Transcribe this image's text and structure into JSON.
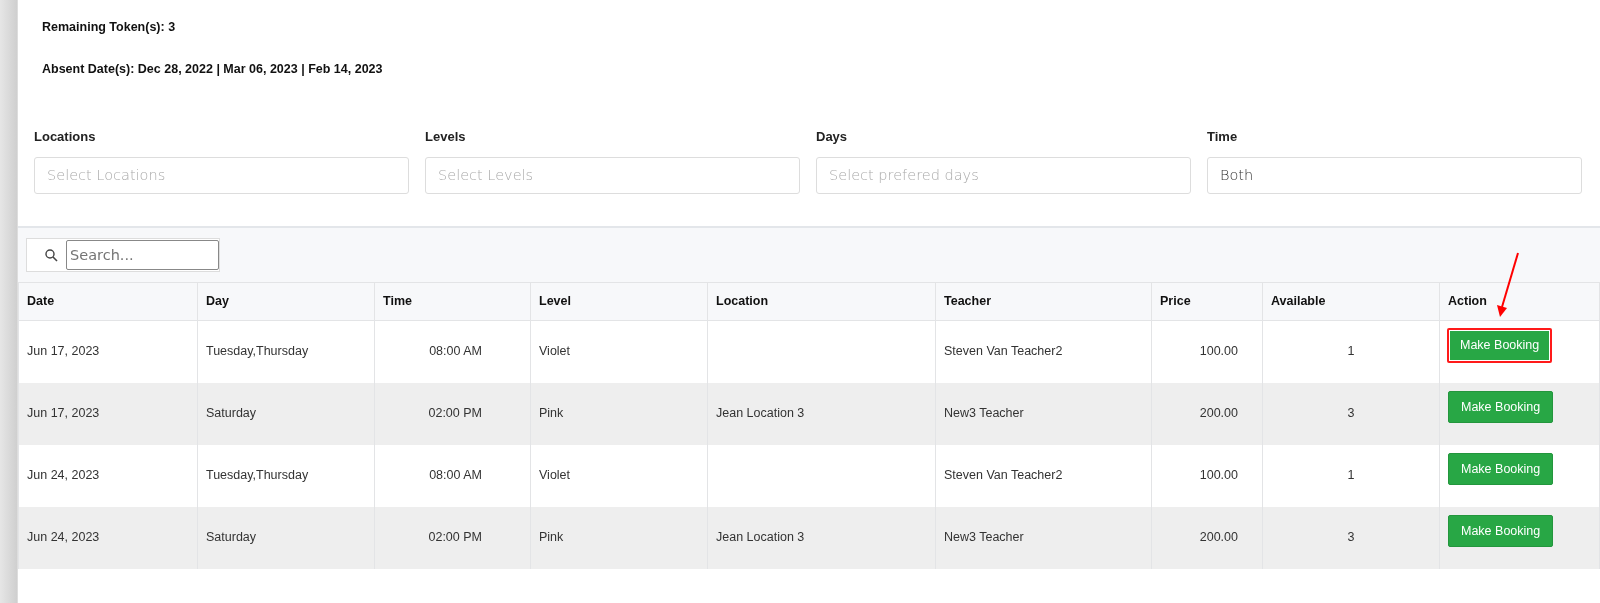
{
  "info": {
    "remaining_label": "Remaining Token(s):",
    "remaining": "3",
    "absent_label": "Absent Date(s):",
    "absent": "Dec 28, 2022 | Mar 06, 2023 | Feb 14, 2023"
  },
  "filters": [
    {
      "label": "Locations",
      "placeholder": "Select Locations"
    },
    {
      "label": "Levels",
      "placeholder": "Select Levels"
    },
    {
      "label": "Days",
      "placeholder": "Select prefered days"
    },
    {
      "label": "Time",
      "value": "Both"
    }
  ],
  "search": {
    "placeholder": "Search..."
  },
  "table": {
    "columns": [
      "Date",
      "Day",
      "Time",
      "Level",
      "Location",
      "Teacher",
      "Price",
      "Available",
      "Action"
    ],
    "rows": [
      {
        "date": "Jun 17, 2023",
        "day": "Tuesday,Thursday",
        "time": "08:00 AM",
        "level": "Violet",
        "location": "",
        "teacher": "Steven Van Teacher2",
        "price": "100.00",
        "available": "1",
        "action": "Make Booking",
        "highlighted": true
      },
      {
        "date": "Jun 17, 2023",
        "day": "Saturday",
        "time": "02:00 PM",
        "level": "Pink",
        "location": "Jean Location 3",
        "teacher": "New3 Teacher",
        "price": "200.00",
        "available": "3",
        "action": "Make Booking",
        "highlighted": false
      },
      {
        "date": "Jun 24, 2023",
        "day": "Tuesday,Thursday",
        "time": "08:00 AM",
        "level": "Violet",
        "location": "",
        "teacher": "Steven Van Teacher2",
        "price": "100.00",
        "available": "1",
        "action": "Make Booking",
        "highlighted": false
      },
      {
        "date": "Jun 24, 2023",
        "day": "Saturday",
        "time": "02:00 PM",
        "level": "Pink",
        "location": "Jean Location 3",
        "teacher": "New3 Teacher",
        "price": "200.00",
        "available": "3",
        "action": "Make Booking",
        "highlighted": false
      }
    ]
  }
}
